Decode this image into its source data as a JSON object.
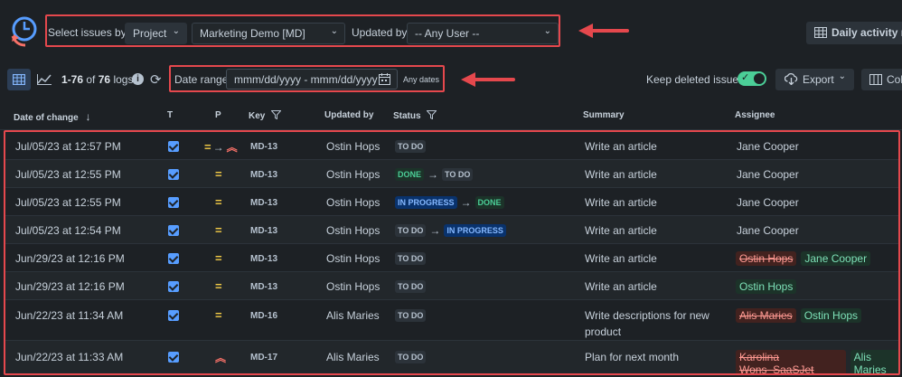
{
  "header": {
    "select_label": "Select issues by:",
    "project_type": "Project",
    "project_value": "Marketing Demo [MD]",
    "updated_by_label": "Updated by:",
    "updated_by_value": "-- Any User --",
    "daily_button": "Daily activity report"
  },
  "toolbar": {
    "count_range": "1-76",
    "count_of": "of",
    "count_total": "76",
    "count_unit": "logs",
    "date_label": "Date range:",
    "date_placeholder": "mmm/dd/yyyy - mmm/dd/yyyy",
    "any_dates": "Any dates",
    "keep_deleted": "Keep deleted issues",
    "export": "Export",
    "columns": "Columns"
  },
  "columns": [
    "Date of change",
    "T",
    "P",
    "Key",
    "Updated by",
    "Status",
    "Summary",
    "Assignee"
  ],
  "rows": [
    {
      "date": "Jul/05/23 at 12:57 PM",
      "key": "MD-13",
      "by": "Ostin Hops",
      "summary": "Write an article",
      "summary2": "",
      "assignee": "Jane Cooper",
      "old": "",
      "new": ""
    },
    {
      "date": "Jul/05/23 at 12:55 PM",
      "key": "MD-13",
      "by": "Ostin Hops",
      "summary": "Write an article",
      "summary2": "",
      "assignee": "Jane Cooper",
      "old": "",
      "new": ""
    },
    {
      "date": "Jul/05/23 at 12:55 PM",
      "key": "MD-13",
      "by": "Ostin Hops",
      "summary": "Write an article",
      "summary2": "",
      "assignee": "Jane Cooper",
      "old": "",
      "new": ""
    },
    {
      "date": "Jul/05/23 at 12:54 PM",
      "key": "MD-13",
      "by": "Ostin Hops",
      "summary": "Write an article",
      "summary2": "",
      "assignee": "Jane Cooper",
      "old": "",
      "new": ""
    },
    {
      "date": "Jun/29/23 at 12:16 PM",
      "key": "MD-13",
      "by": "Ostin Hops",
      "summary": "Write an article",
      "summary2": "",
      "assignee": "",
      "old": "Ostin Hops",
      "new": "Jane Cooper"
    },
    {
      "date": "Jun/29/23 at 12:16 PM",
      "key": "MD-13",
      "by": "Ostin Hops",
      "summary": "Write an article",
      "summary2": "",
      "assignee": "",
      "old": "",
      "new": "Ostin Hops"
    },
    {
      "date": "Jun/22/23 at 11:34 AM",
      "key": "MD-16",
      "by": "Alis Maries",
      "summary": "Write descriptions for new",
      "summary2": "product",
      "assignee": "",
      "old": "Alis Maries",
      "new": "Ostin Hops"
    },
    {
      "date": "Jun/22/23 at 11:33 AM",
      "key": "MD-17",
      "by": "Alis Maries",
      "summary": "Plan for next month",
      "summary2": "",
      "assignee": "",
      "old": "Karolina Wons_SaaSJet",
      "new": "Alis Maries"
    }
  ],
  "status_labels": {
    "todo": "TO DO",
    "done": "DONE",
    "progress": "IN PROGRESS"
  },
  "colors": {
    "accent_red": "#e5484d",
    "done_green": "#4bce97",
    "progress_blue": "#85b8ff",
    "medium_priority": "#f5cd47",
    "high_priority": "#f87168"
  }
}
